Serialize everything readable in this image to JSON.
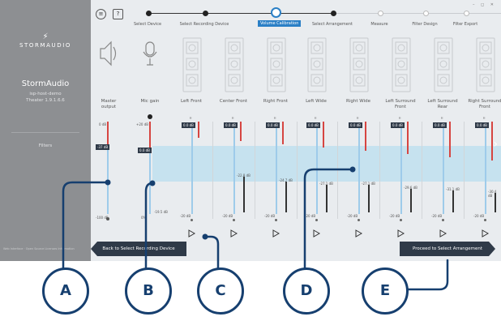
{
  "sidebar": {
    "logo": "STORMAUDIO",
    "title": "StormAudio",
    "host": "isp-host-demo",
    "version": "Theater 1.9.1.6.6",
    "filters": "Filters",
    "footer": "Web Interface · Open Source Licenses Information"
  },
  "toolbar": {
    "menu_icon": "≡",
    "help_label": "?",
    "window_controls": "– ◻ ✕"
  },
  "steps": [
    {
      "label": "Select Device",
      "state": "done"
    },
    {
      "label": "Select Recording Device",
      "state": "done"
    },
    {
      "label": "Volume Calibration",
      "state": "active"
    },
    {
      "label": "Select Arrangement",
      "state": "done"
    },
    {
      "label": "Measure",
      "state": "todo"
    },
    {
      "label": "Filter Design",
      "state": "todo"
    },
    {
      "label": "Filter Export",
      "state": "todo"
    }
  ],
  "master": {
    "label": "Master output",
    "top": "0 dB",
    "bottom": "-100 dB",
    "value": "-37 dB",
    "level": 0.37
  },
  "mic": {
    "label": "Mic gain",
    "top": "+20 dB",
    "bottom": "0%",
    "value": "0.0 dB",
    "reading": "-19.5 dB",
    "level": 0.45
  },
  "channels": [
    {
      "label": "Left Front",
      "gain": "0.0 dB",
      "reading": "",
      "level": 0.0
    },
    {
      "label": "Center Front",
      "gain": "0.0 dB",
      "reading": "-22.8 dB",
      "level": 0.55
    },
    {
      "label": "Right Front",
      "gain": "0.0 dB",
      "reading": "-24.7 dB",
      "level": 0.48
    },
    {
      "label": "Left Wide",
      "gain": "0.0 dB",
      "reading": "-27.1 dB",
      "level": 0.42
    },
    {
      "label": "Right Wide",
      "gain": "0.0 dB",
      "reading": "-27.1 dB",
      "level": 0.42
    },
    {
      "label": "Left Surround Front",
      "gain": "0.0 dB",
      "reading": "-29.6 dB",
      "level": 0.36
    },
    {
      "label": "Left Surround Rear",
      "gain": "0.0 dB",
      "reading": "-31.1 dB",
      "level": 0.34
    },
    {
      "label": "Right Surround Front",
      "gain": "0.0 dB",
      "reading": "-30.4 dB",
      "level": 0.3
    }
  ],
  "scale": {
    "min": "-20 dB",
    "max": "0 dB"
  },
  "buttons": {
    "back": "Back to Select Recording Device",
    "proceed": "Proceed to Select Arrangement"
  },
  "callouts": [
    "A",
    "B",
    "C",
    "D",
    "E"
  ],
  "colors": {
    "accent": "#2a7fc6",
    "callout": "#163f6f",
    "meter_red": "#d64541",
    "band": "#bfe0ef",
    "button": "#2f3a48"
  }
}
